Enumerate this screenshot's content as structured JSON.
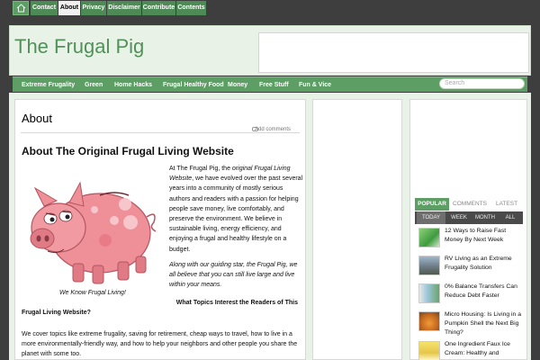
{
  "topnav": {
    "items": [
      {
        "label": "Contact",
        "active": false
      },
      {
        "label": "About",
        "active": true
      },
      {
        "label": "Privacy",
        "active": false
      },
      {
        "label": "Disclaimer",
        "active": false
      },
      {
        "label": "Contribute",
        "active": false
      },
      {
        "label": "Contents",
        "active": false
      }
    ],
    "home_icon": "home-icon"
  },
  "header": {
    "site_title": "The Frugal Pig"
  },
  "mainnav": {
    "items": [
      "Extreme Frugality",
      "Green",
      "Home Hacks",
      "Frugal Healthy Food",
      "Money",
      "Free Stuff",
      "Fun & Vice"
    ],
    "search_placeholder": "Search"
  },
  "content": {
    "page_title": "About",
    "add_comments": "Add comments",
    "heading": "About The Original Frugal Living Website",
    "image_caption": "We Know Frugal Living!",
    "intro": {
      "before": "At The Frugal Pig, the ",
      "emphasis": "original Frugal Living Website",
      "after": ", we have evolved over the past several years into a community of mostly serious authors and readers with a passion for helping people save money, live comfortably, and preserve the environment. We believe in sustainable living, energy efficiency, and enjoying a frugal and healthy lifestyle on a budget."
    },
    "star_paragraph": "Along with our guiding star, the Frugal Pig, we all believe that you can still live large and live within your means.",
    "topics_question_line1": "What Topics Interest the Readers of This",
    "topics_question_line2": "Frugal Living Website?",
    "topics_paragraph": "We cover topics like extreme frugality, saving for retirement, cheap ways to travel, how to live in a more environmentally-friendly way, and how to help your neighbors and other people you share the planet with some too."
  },
  "sidebar": {
    "tabs": [
      {
        "label": "POPULAR",
        "active": true
      },
      {
        "label": "COMMENTS",
        "active": false
      },
      {
        "label": "LATEST",
        "active": false
      }
    ],
    "subtabs": [
      {
        "label": "TODAY",
        "active": true
      },
      {
        "label": "WEEK",
        "active": false
      },
      {
        "label": "MONTH",
        "active": false
      },
      {
        "label": "ALL",
        "active": false
      }
    ],
    "posts": [
      {
        "title": "12 Ways to Raise Fast Money By Next Week"
      },
      {
        "title": "RV Living as an Extreme Frugality Solution"
      },
      {
        "title": "0% Balance Transfers Can Reduce Debt Faster"
      },
      {
        "title": "Micro Housing: Is Living in a Pumpkin Shell the Next Big Thing?"
      },
      {
        "title": "One Ingredient Faux Ice Cream: Healthy and"
      }
    ]
  },
  "colors": {
    "accent_green": "#5c9e64",
    "title_green": "#4f9159",
    "header_bg": "#e9f2e6",
    "dark_bg": "#3e3e3e"
  }
}
